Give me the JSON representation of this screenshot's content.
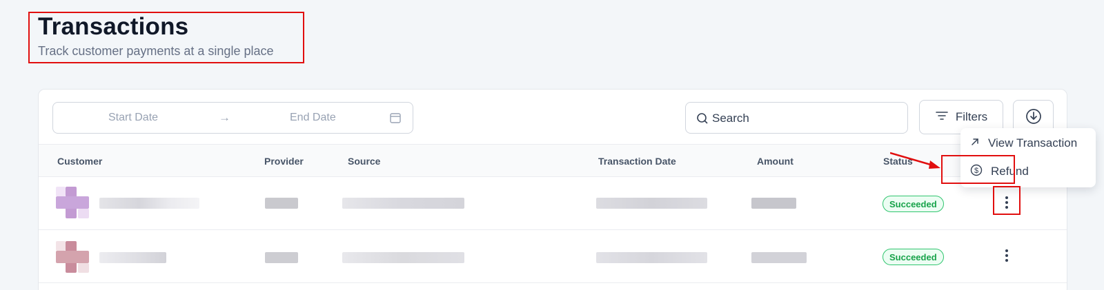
{
  "header": {
    "title": "Transactions",
    "subtitle": "Track customer payments at a single place"
  },
  "toolbar": {
    "start_date_placeholder": "Start Date",
    "arrow": "→",
    "end_date_placeholder": "End Date",
    "search_placeholder": "Search",
    "filters_label": "Filters"
  },
  "table": {
    "columns": [
      "Customer",
      "Provider",
      "Source",
      "Transaction Date",
      "Amount",
      "Status"
    ],
    "rows": [
      {
        "status": "Succeeded"
      },
      {
        "status": "Succeeded"
      }
    ]
  },
  "row_menu": {
    "items": [
      "View Transaction",
      "Refund"
    ]
  },
  "colors": {
    "status_success": "#17a34a",
    "annotation_red": "#e10e0e"
  },
  "icons": [
    "calendar-icon",
    "search-icon",
    "filter-icon",
    "download-icon",
    "arrow-up-right-icon",
    "dollar-circle-icon",
    "kebab-menu-icon"
  ]
}
